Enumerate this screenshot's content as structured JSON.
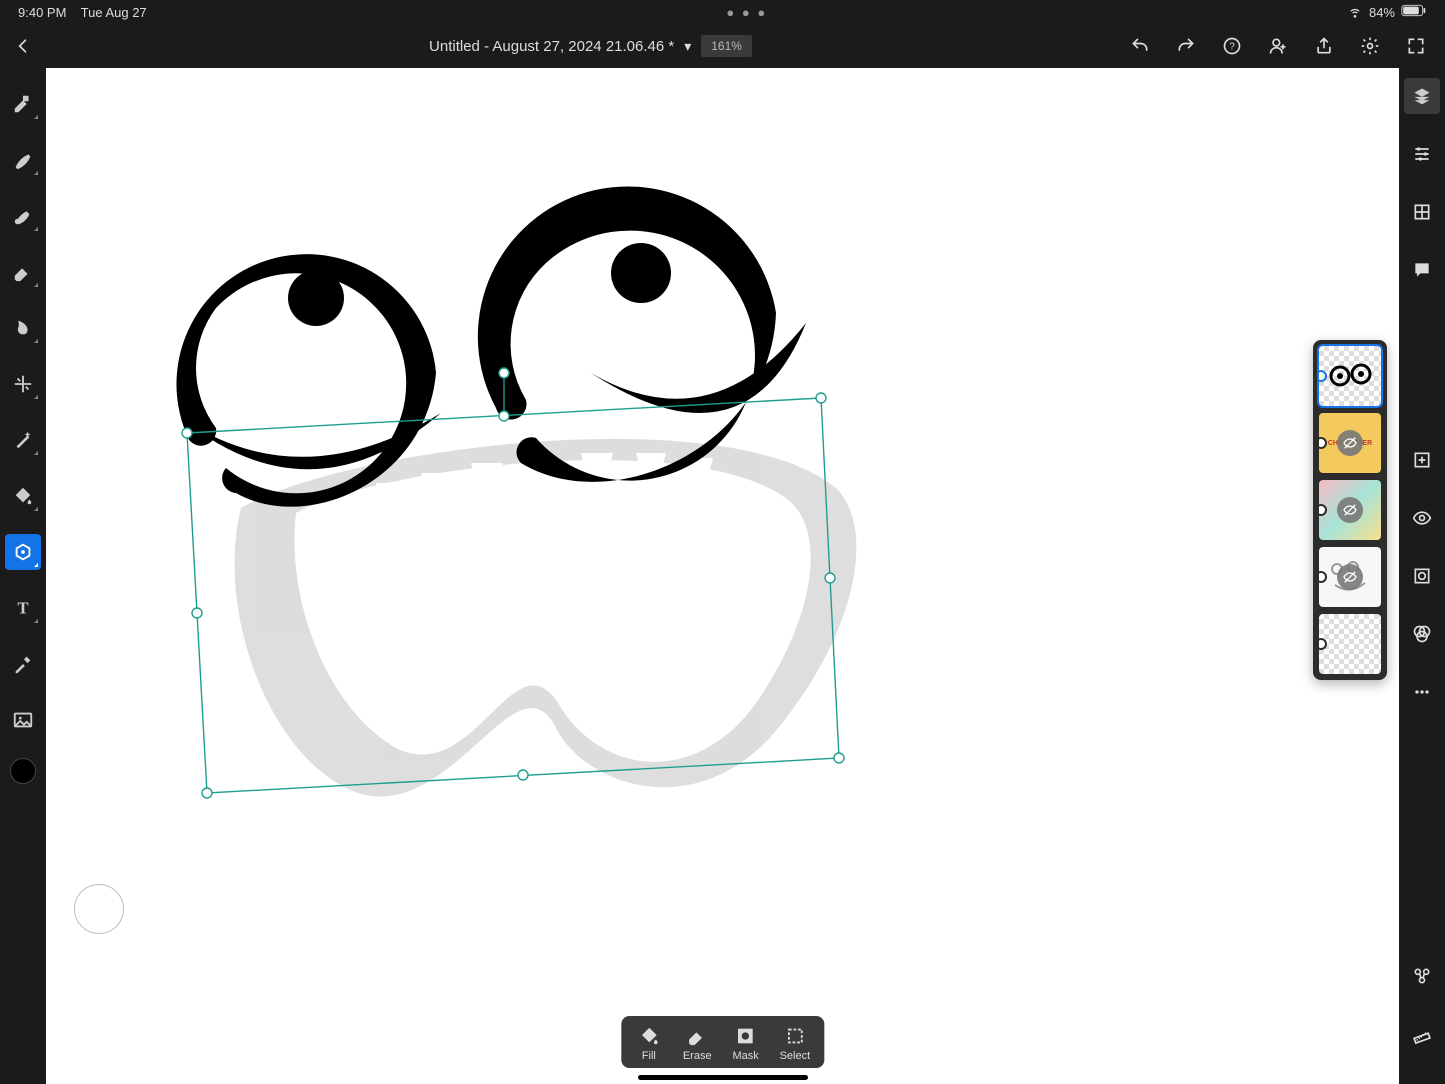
{
  "status": {
    "time": "9:40 PM",
    "date": "Tue Aug 27",
    "battery": "84%"
  },
  "header": {
    "title": "Untitled - August 27, 2024 21.06.46 *",
    "zoom": "161%"
  },
  "bottom_actions": {
    "fill": "Fill",
    "erase": "Erase",
    "mask": "Mask",
    "select": "Select"
  },
  "layers": [
    {
      "name": "eyes-layer",
      "selected": true,
      "hidden": false
    },
    {
      "name": "character-layer",
      "selected": false,
      "hidden": true,
      "label": "CHARACTER"
    },
    {
      "name": "blobs-layer",
      "selected": false,
      "hidden": true
    },
    {
      "name": "sketch-layer",
      "selected": false,
      "hidden": true
    },
    {
      "name": "blank-layer",
      "selected": false,
      "hidden": false
    }
  ],
  "colors": {
    "primary": "#000000",
    "accent": "#1473e6",
    "selection": "#1e9e8f"
  }
}
